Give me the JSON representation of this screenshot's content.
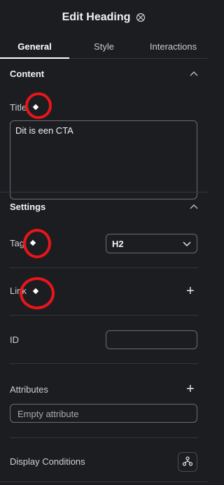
{
  "header": {
    "title": "Edit Heading",
    "icon": "globe-grid-icon"
  },
  "tabs": [
    {
      "label": "General",
      "active": true
    },
    {
      "label": "Style",
      "active": false
    },
    {
      "label": "Interactions",
      "active": false
    }
  ],
  "content_section": {
    "title": "Content",
    "title_field": {
      "label": "Title",
      "value": "Dit is een CTA"
    }
  },
  "settings_section": {
    "title": "Settings",
    "tag": {
      "label": "Tag",
      "value": "H2"
    },
    "link": {
      "label": "Link"
    },
    "id": {
      "label": "ID",
      "value": ""
    },
    "attributes": {
      "label": "Attributes",
      "placeholder": "Empty attribute"
    },
    "display_conditions": {
      "label": "Display Conditions",
      "icon": "hierarchy-icon"
    }
  },
  "colors": {
    "background": "#1c1d21",
    "annotation_ring": "#e8151b",
    "border": "#6b6d73"
  }
}
